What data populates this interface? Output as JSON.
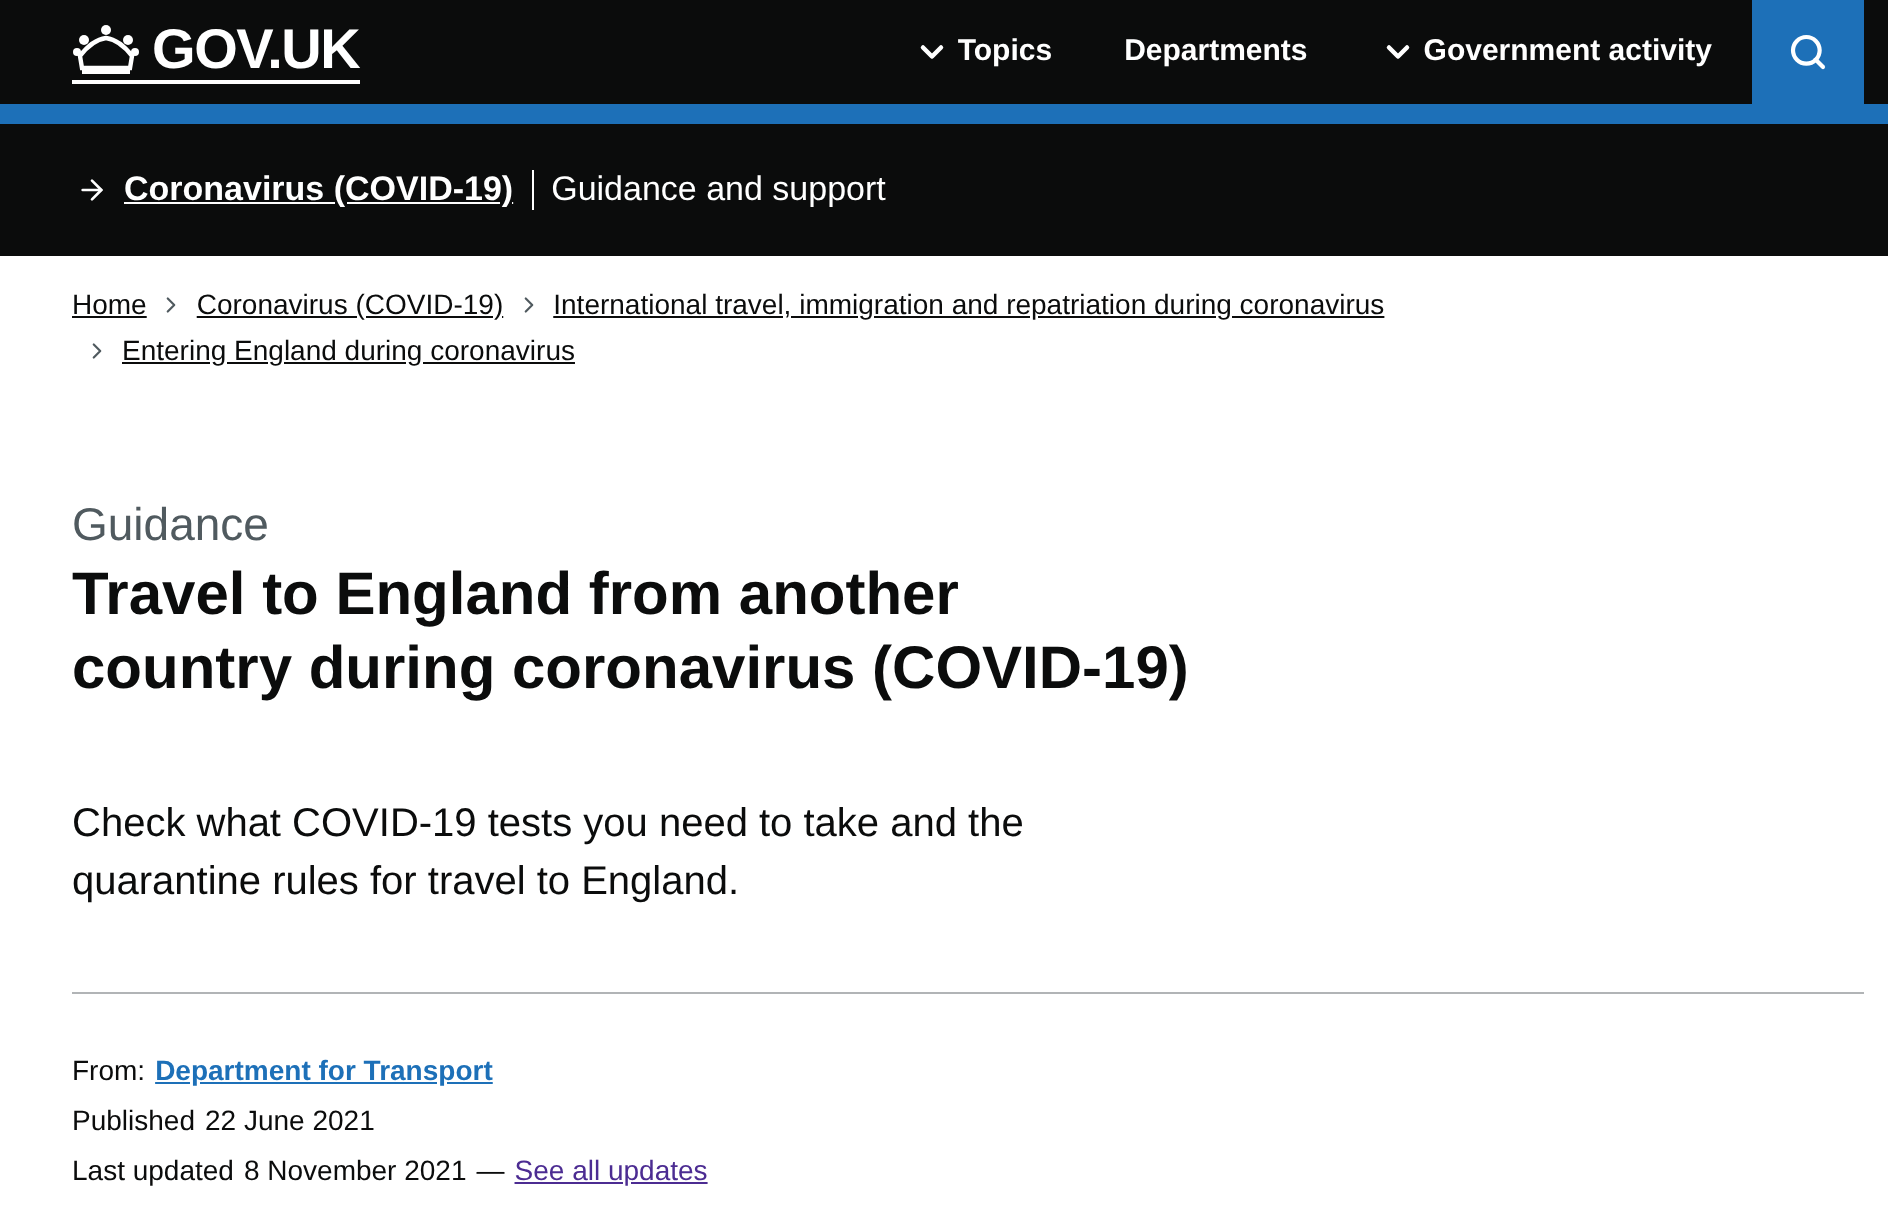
{
  "header": {
    "logo": "GOV.UK",
    "nav": [
      {
        "label": "Topics",
        "kind": "dropdown"
      },
      {
        "label": "Departments",
        "kind": "link"
      },
      {
        "label": "Government activity",
        "kind": "dropdown"
      }
    ]
  },
  "topic_bar": {
    "link": "Coronavirus (COVID-19)",
    "text": "Guidance and support"
  },
  "breadcrumbs": [
    {
      "label": "Home"
    },
    {
      "label": "Coronavirus (COVID-19)"
    },
    {
      "label": "International travel, immigration and repatriation during coronavirus"
    },
    {
      "label": "Entering England during coronavirus"
    }
  ],
  "document_type": "Guidance",
  "title_lines": [
    "Travel to England from another",
    "country during coronavirus (COVID-19)"
  ],
  "description": "Check what COVID-19 tests you need to take and the quarantine rules for travel to England.",
  "metadata": {
    "from_label": "From:",
    "from_link": "Department for Transport",
    "published_label": "Published",
    "published_date": "22 June 2021",
    "updated_label": "Last updated",
    "updated_date": "8 November 2021",
    "separator": "—",
    "updates_link": {
      "label": "See all updates",
      "visited": true
    }
  }
}
